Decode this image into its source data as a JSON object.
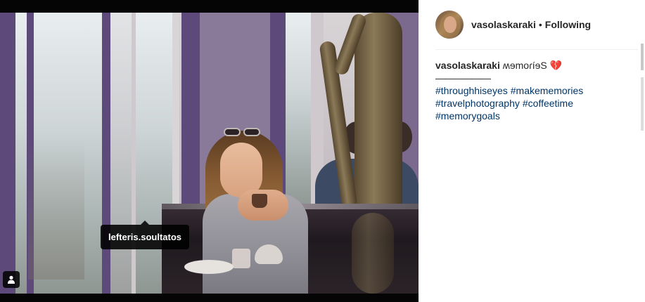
{
  "post": {
    "tagged_user": "lefteris.soultatos",
    "tag_icon": "person-icon"
  },
  "header": {
    "username": "vasolaskaraki",
    "separator": "•",
    "follow_status": "Following"
  },
  "caption": {
    "username": "vasolaskaraki",
    "text": "ʍɘmoɾíɘS 💔",
    "rule": "——————",
    "hashtags": [
      "#throughhiseyes",
      "#makememories",
      "#travelphotography",
      "#coffeetime",
      "#memorygoals"
    ]
  },
  "colors": {
    "hashtag": "#003569",
    "text": "#262626",
    "tooltip_bg": "#000000"
  }
}
